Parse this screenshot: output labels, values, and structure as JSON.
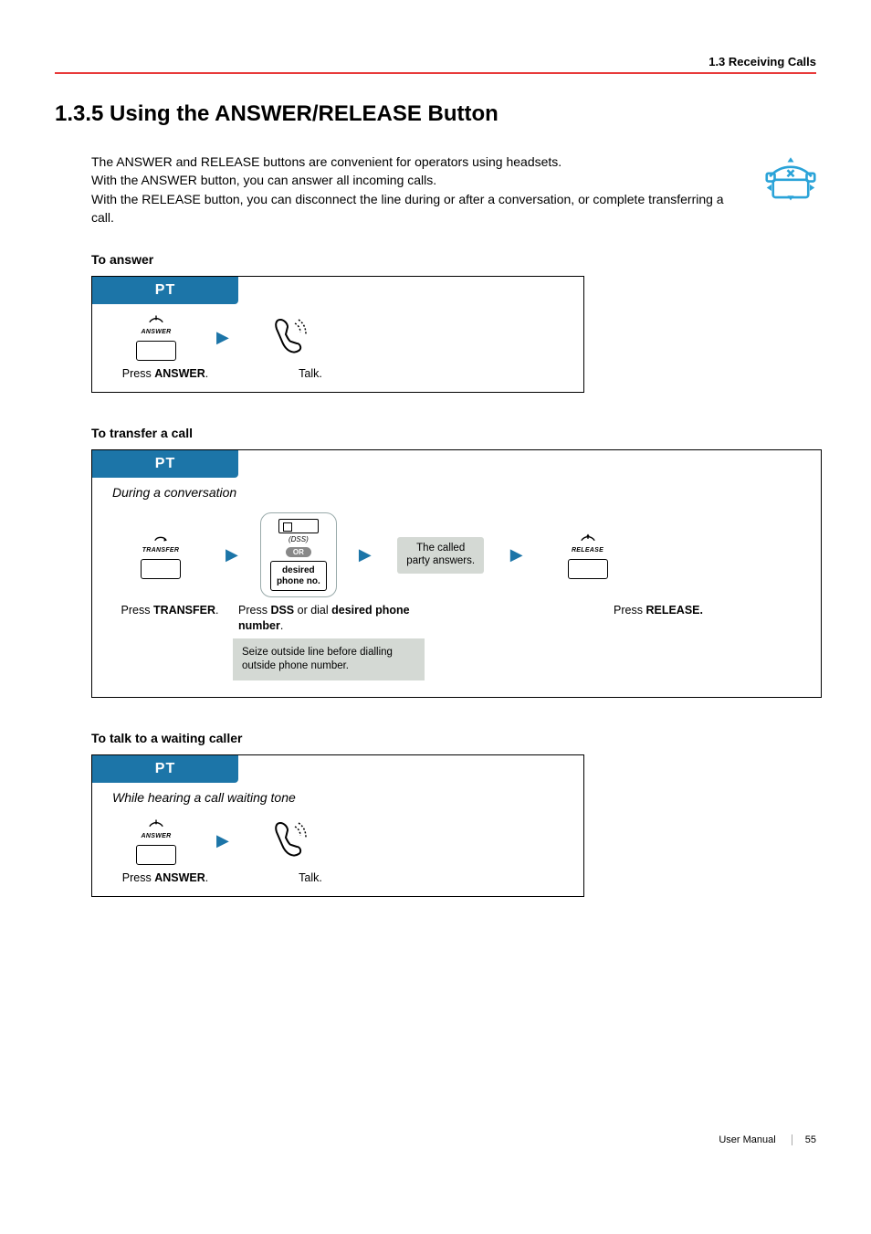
{
  "header": {
    "breadcrumb": "1.3 Receiving Calls"
  },
  "title": "1.3.5   Using the ANSWER/RELEASE Button",
  "intro": {
    "line1": "The ANSWER and RELEASE buttons are convenient for operators using headsets.",
    "line2": "With the ANSWER button, you can answer all incoming calls.",
    "line3": "With the RELEASE button, you can disconnect the line during or after a conversation, or complete transferring a call."
  },
  "pt_label": "PT",
  "sections": {
    "answer": {
      "heading": "To answer",
      "btn_label": "ANSWER",
      "caption_press_pre": "Press ",
      "caption_press_btn": "ANSWER",
      "caption_press_post": ".",
      "caption_talk": "Talk."
    },
    "transfer": {
      "heading": "To transfer a call",
      "context": "During a conversation",
      "transfer_btn": "TRANSFER",
      "dss_label": "(DSS)",
      "or_label": "OR",
      "desired_l1": "desired",
      "desired_l2": "phone no.",
      "called_l1": "The called",
      "called_l2": "party answers.",
      "release_btn": "RELEASE",
      "cap_transfer_pre": "Press ",
      "cap_transfer_btn": "TRANSFER",
      "cap_transfer_post": ".",
      "cap_dss_pre": "Press ",
      "cap_dss_b1": "DSS",
      "cap_dss_mid": " or dial ",
      "cap_dss_b2": "desired phone number",
      "cap_dss_post": ".",
      "cap_release_pre": "Press ",
      "cap_release_btn": "RELEASE.",
      "note": "Seize outside line before dialling outside phone number."
    },
    "waiting": {
      "heading": "To talk to a waiting caller",
      "context": "While hearing a call waiting tone",
      "btn_label": "ANSWER",
      "caption_press_pre": "Press ",
      "caption_press_btn": "ANSWER",
      "caption_press_post": ".",
      "caption_talk": "Talk."
    }
  },
  "footer": {
    "manual": "User Manual",
    "page": "55"
  }
}
